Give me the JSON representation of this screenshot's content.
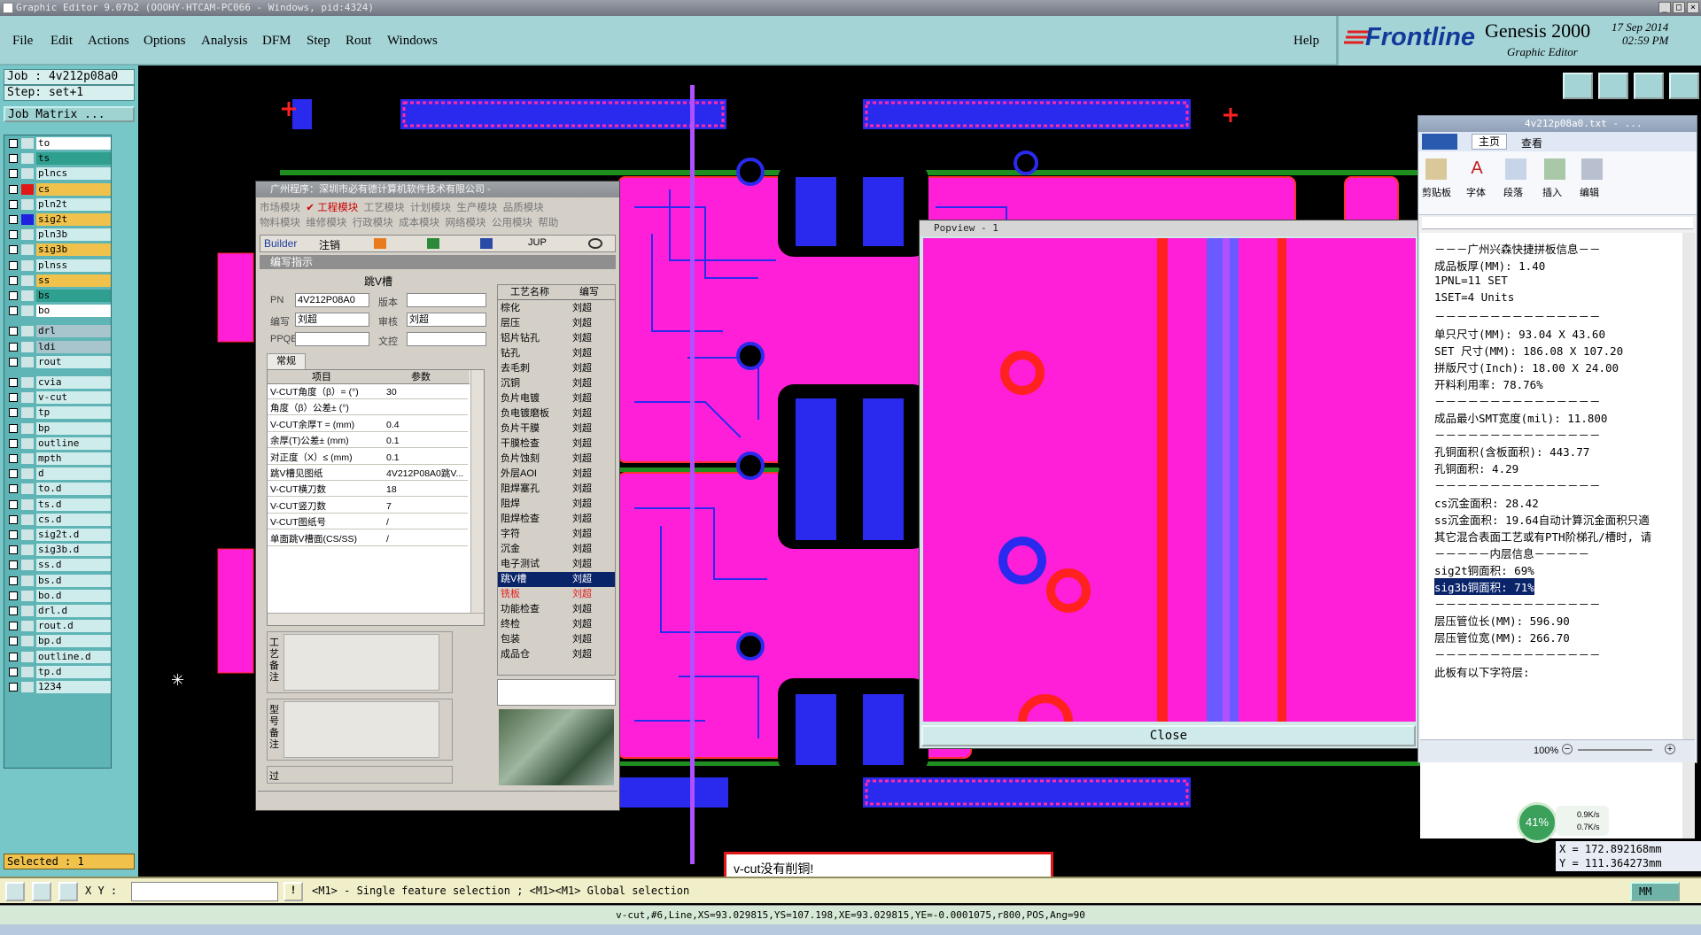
{
  "title_bar": {
    "text": "Graphic Editor 9.07b2 (OOOHY-HTCAM-PC066 - Windows, pid:4324)"
  },
  "menu": [
    "File",
    "Edit",
    "Actions",
    "Options",
    "Analysis",
    "DFM",
    "Step",
    "Rout",
    "Windows"
  ],
  "help_label": "Help",
  "brand": {
    "logo": "Frontline",
    "product": "Genesis 2000",
    "subtitle": "Graphic Editor",
    "date": "17 Sep 2014",
    "time": "02:59 PM"
  },
  "left_panel": {
    "job": "Job : 4v212p08a0",
    "step": "Step: set+1",
    "job_matrix": "Job Matrix ...",
    "layers": [
      {
        "name": "to",
        "color": "#ffffff"
      },
      {
        "name": "ts",
        "color": "#2f9f8f"
      },
      {
        "name": "plncs",
        "color": "#cfecec"
      },
      {
        "name": "cs",
        "color": "#f1c24b",
        "swatch": "#e01818"
      },
      {
        "name": "pln2t",
        "color": "#cfecec"
      },
      {
        "name": "sig2t",
        "color": "#f1c24b",
        "swatch": "#2020e0"
      },
      {
        "name": "pln3b",
        "color": "#cfecec"
      },
      {
        "name": "sig3b",
        "color": "#f1c24b"
      },
      {
        "name": "plnss",
        "color": "#cfecec"
      },
      {
        "name": "ss",
        "color": "#f1c24b"
      },
      {
        "name": "bs",
        "color": "#2f9f8f"
      },
      {
        "name": "bo",
        "color": "#ffffff"
      },
      {
        "name": "drl",
        "color": "#a8c4cc"
      },
      {
        "name": "ldi",
        "color": "#a8c4cc"
      },
      {
        "name": "rout",
        "color": "#cfecec"
      },
      {
        "name": "cvia",
        "color": "#cfecec"
      },
      {
        "name": "v-cut",
        "color": "#cfecec"
      },
      {
        "name": "tp",
        "color": "#cfecec"
      },
      {
        "name": "bp",
        "color": "#cfecec"
      },
      {
        "name": "outline",
        "color": "#cfecec"
      },
      {
        "name": "mpth",
        "color": "#cfecec"
      },
      {
        "name": "d",
        "color": "#cfecec"
      },
      {
        "name": "to.d",
        "color": "#cfecec"
      },
      {
        "name": "ts.d",
        "color": "#cfecec"
      },
      {
        "name": "cs.d",
        "color": "#cfecec"
      },
      {
        "name": "sig2t.d",
        "color": "#cfecec"
      },
      {
        "name": "sig3b.d",
        "color": "#cfecec"
      },
      {
        "name": "ss.d",
        "color": "#cfecec"
      },
      {
        "name": "bs.d",
        "color": "#cfecec"
      },
      {
        "name": "bo.d",
        "color": "#cfecec"
      },
      {
        "name": "drl.d",
        "color": "#cfecec"
      },
      {
        "name": "rout.d",
        "color": "#cfecec"
      },
      {
        "name": "bp.d",
        "color": "#cfecec"
      },
      {
        "name": "outline.d",
        "color": "#cfecec"
      },
      {
        "name": "tp.d",
        "color": "#cfecec"
      },
      {
        "name": "1234",
        "color": "#cfecec"
      }
    ],
    "selected": "Selected : 1"
  },
  "mes_dialog": {
    "title": "广州程序：深圳市必有德计算机软件技术有限公司 -",
    "menu_row1": [
      "市场模块",
      "✔ 工程模块",
      "工艺模块",
      "计划模块",
      "生产模块",
      "品质模块"
    ],
    "menu_row2": [
      "物料模块",
      "维修模块",
      "行政模块",
      "成本模块",
      "网络模块",
      "公用模块",
      "帮助"
    ],
    "toolbar": [
      "Builder",
      "注销",
      "",
      "",
      "",
      "JUP",
      ""
    ],
    "section": "编写指示",
    "heading": "跳V槽",
    "fields": {
      "pn_label": "PN",
      "pn": "4V212P08A0",
      "version_label": "版本",
      "version": "",
      "writer_label": "编写",
      "writer": "刘超",
      "reviewer_label": "审核",
      "reviewer": "刘超",
      "ppqe_label": "PPQE",
      "ppqe": "",
      "doc_label": "文控",
      "doc": ""
    },
    "tab": "常规",
    "param_headers": [
      "项目",
      "参数"
    ],
    "params": [
      [
        "V-CUT角度（β）=  (°)",
        "30"
      ],
      [
        "角度（β）公差±  (°)",
        ""
      ],
      [
        "V-CUT余厚T =  (mm)",
        "0.4"
      ],
      [
        "余厚(T)公差±  (mm)",
        "0.1"
      ],
      [
        "对正度（X）≤ (mm)",
        "0.1"
      ],
      [
        "跳V槽见图纸",
        "4V212P08A0跳V..."
      ],
      [
        "V-CUT横刀数",
        "18"
      ],
      [
        "V-CUT竖刀数",
        "7"
      ],
      [
        "V-CUT图纸号",
        "/"
      ],
      [
        "单面跳V槽面(CS/SS)",
        "/"
      ]
    ],
    "note_labels": [
      "工艺备注",
      "型号备注",
      "过"
    ],
    "process_headers": [
      "工艺名称",
      "编写"
    ],
    "process": [
      [
        "棕化",
        "刘超"
      ],
      [
        "层压",
        "刘超"
      ],
      [
        "铝片钻孔",
        "刘超"
      ],
      [
        "钻孔",
        "刘超"
      ],
      [
        "去毛刺",
        "刘超"
      ],
      [
        "沉铜",
        "刘超"
      ],
      [
        "负片电镀",
        "刘超"
      ],
      [
        "负电镀磨板",
        "刘超"
      ],
      [
        "负片干膜",
        "刘超"
      ],
      [
        "干膜检查",
        "刘超"
      ],
      [
        "负片蚀刻",
        "刘超"
      ],
      [
        "外层AOI",
        "刘超"
      ],
      [
        "阻焊塞孔",
        "刘超"
      ],
      [
        "阻焊",
        "刘超"
      ],
      [
        "阻焊检查",
        "刘超"
      ],
      [
        "字符",
        "刘超"
      ],
      [
        "沉金",
        "刘超"
      ],
      [
        "电子测试",
        "刘超"
      ],
      [
        "跳V槽",
        "刘超"
      ],
      [
        "铣板",
        "刘超"
      ],
      [
        "功能检查",
        "刘超"
      ],
      [
        "终检",
        "刘超"
      ],
      [
        "包装",
        "刘超"
      ],
      [
        "成品仓",
        "刘超"
      ]
    ],
    "selected_process_index": 18
  },
  "popview": {
    "title": "Popview - 1",
    "close": "Close"
  },
  "notepad": {
    "title": "4v212p08a0.txt - ...",
    "tabs": [
      "主页",
      "查看"
    ],
    "ribbon": [
      "剪贴板",
      "字体",
      "段落",
      "插入",
      "编辑"
    ],
    "lines": [
      "－－－广州兴森快捷拼板信息－－",
      "成品板厚(MM): 1.40",
      "1PNL=11 SET",
      "1SET=4 Units",
      "－－－－－－－－－－－－－－－",
      "单只尺寸(MM): 93.04 X 43.60",
      "SET 尺寸(MM): 186.08 X 107.20",
      "拼版尺寸(Inch): 18.00 X 24.00",
      "开料利用率: 78.76%",
      "－－－－－－－－－－－－－－－",
      "成品最小SMT宽度(mil): 11.800",
      "－－－－－－－－－－－－－－－",
      "孔铜面积(含板面积): 443.77",
      "孔铜面积: 4.29",
      "－－－－－－－－－－－－－－－",
      "cs沉金面积: 28.42",
      "ss沉金面积: 19.64自动计算沉金面积只適",
      "其它混合表面工艺或有PTH阶梯孔/槽时, 请",
      "－－－－－内层信息－－－－－",
      "sig2t铜面积: 69%",
      "sig3b铜面积: 71%",
      "－－－－－－－－－－－－－－－",
      "层压管位长(MM): 596.90",
      "层压管位宽(MM): 266.70",
      "－－－－－－－－－－－－－－－",
      "此板有以下字符层:"
    ],
    "highlight_index": 20,
    "zoom": "100%"
  },
  "network": {
    "percent": "41%",
    "up": "0.9K/s",
    "down": "0.7K/s"
  },
  "coords": {
    "x": "X = 172.892168mm",
    "y": "Y = 111.364273mm"
  },
  "alert": "v-cut没有削铜!",
  "bottom": {
    "xy_label": "X Y :",
    "xy_value": "",
    "hint": "<M1> - Single feature selection ; <M1><M1> Global selection",
    "units": "MM"
  },
  "status": "v-cut,#6,Line,XS=93.029815,YS=107.198,XE=93.029815,YE=-0.0001075,r800,POS,Ang=90"
}
